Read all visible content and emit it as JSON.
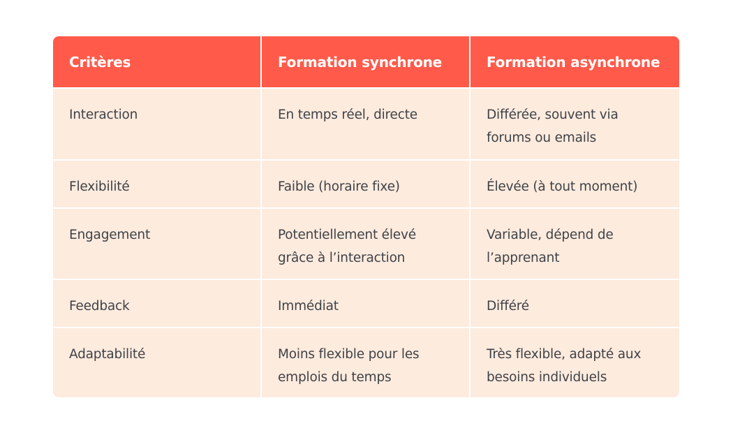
{
  "table": {
    "headers": [
      "Critères",
      "Formation synchrone",
      "Formation asynchrone"
    ],
    "rows": [
      [
        "Interaction",
        "En temps réel, directe",
        "Différée, souvent via forums ou emails"
      ],
      [
        "Flexibilité",
        "Faible (horaire fixe)",
        "Élevée (à tout moment)"
      ],
      [
        "Engagement",
        "Potentiellement élevé grâce à l’interaction",
        "Variable, dépend de l’apprenant"
      ],
      [
        "Feedback",
        "Immédiat",
        "Différé"
      ],
      [
        "Adaptabilité",
        "Moins flexible pour les emplois du temps",
        "Très flexible, adapté aux besoins individuels"
      ]
    ]
  },
  "colors": {
    "header_bg": "#ff5a4a",
    "body_bg": "#fdebde",
    "header_text": "#ffffff",
    "body_text": "#3f4247"
  }
}
